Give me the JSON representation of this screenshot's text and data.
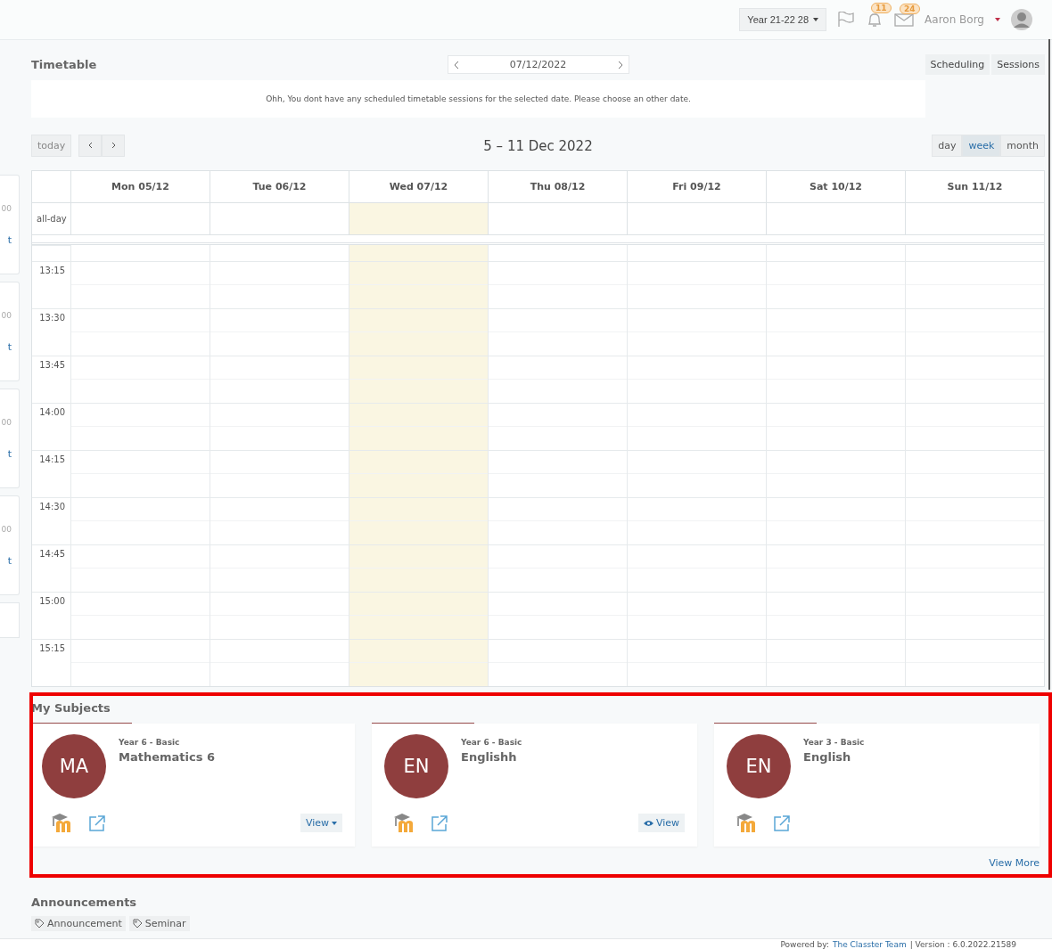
{
  "topbar": {
    "year_selector": "Year 21-22 28",
    "notifications_count": "11",
    "messages_count": "24",
    "user_name": "Aaron Borg"
  },
  "side_strip": [
    {
      "time": "00",
      "link": "t"
    },
    {
      "time": "00",
      "link": "t"
    },
    {
      "time": "00",
      "link": "t"
    },
    {
      "time": "00",
      "link": "t"
    }
  ],
  "timetable": {
    "title": "Timetable",
    "date": "07/12/2022",
    "tabs": [
      {
        "label": "Scheduling",
        "selected": false
      },
      {
        "label": "Sessions",
        "selected": false
      }
    ],
    "message": "Ohh, You dont have any scheduled timetable sessions for the selected date. Please choose an other date."
  },
  "calendar": {
    "today_button": "today",
    "range_title": "5 – 11 Dec 2022",
    "views": [
      {
        "label": "day",
        "selected": false
      },
      {
        "label": "week",
        "selected": true
      },
      {
        "label": "month",
        "selected": false
      }
    ],
    "days": [
      {
        "label": "Mon 05/12",
        "today": false
      },
      {
        "label": "Tue 06/12",
        "today": false
      },
      {
        "label": "Wed 07/12",
        "today": true
      },
      {
        "label": "Thu 08/12",
        "today": false
      },
      {
        "label": "Fri 09/12",
        "today": false
      },
      {
        "label": "Sat 10/12",
        "today": false
      },
      {
        "label": "Sun 11/12",
        "today": false
      }
    ],
    "all_day_label": "all-day",
    "times": [
      "13:15",
      "13:30",
      "13:45",
      "14:00",
      "14:15",
      "14:30",
      "14:45",
      "15:00",
      "15:15"
    ]
  },
  "my_subjects": {
    "title": "My Subjects",
    "highlighted": true,
    "subjects": [
      {
        "initials": "MA",
        "color": "#8f3e3e",
        "level": "Year 6 - Basic",
        "name": "Mathematics 6",
        "view": {
          "kind": "dropdown",
          "label": "View"
        }
      },
      {
        "initials": "EN",
        "color": "#8f3e3e",
        "level": "Year 6 - Basic",
        "name": "Englishh",
        "view": {
          "kind": "eye",
          "label": "View"
        }
      },
      {
        "initials": "EN",
        "color": "#8f3e3e",
        "level": "Year 3 - Basic",
        "name": "English"
      }
    ],
    "view_more": "View More"
  },
  "announcements": {
    "title": "Announcements",
    "tags": [
      "Announcement",
      "Seminar"
    ]
  },
  "footer": {
    "powered_by": "Powered by:",
    "team_link": "The Classter Team",
    "version": "| Version : 6.0.2022.21589"
  }
}
